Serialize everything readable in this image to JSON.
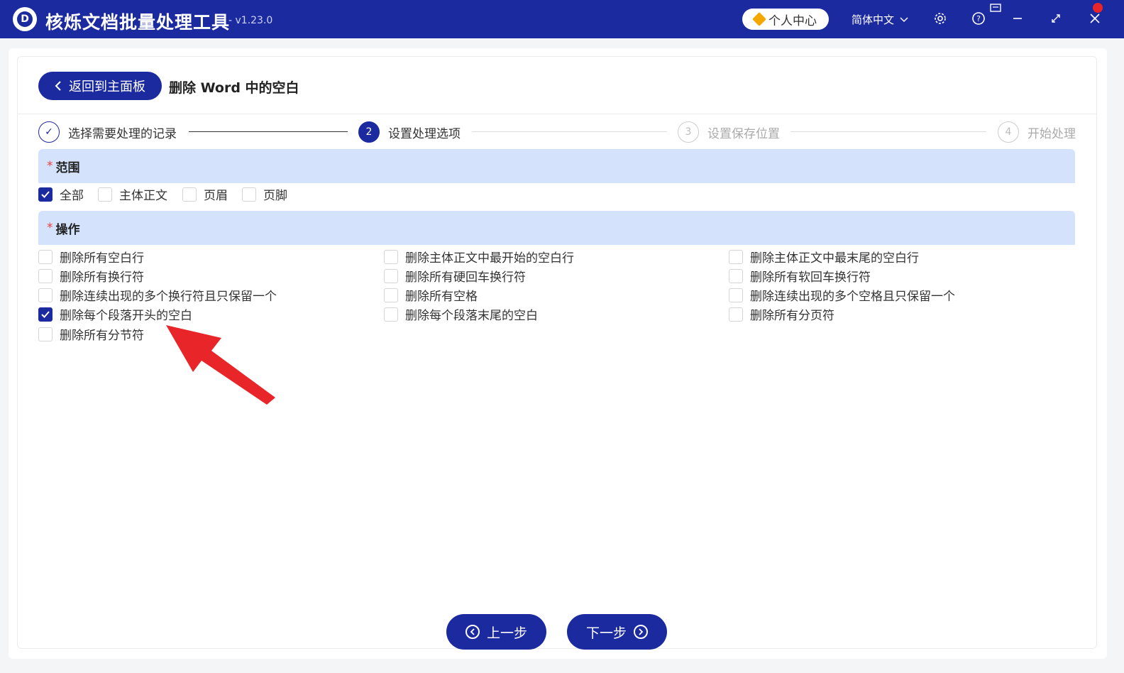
{
  "app": {
    "title": "核烁文档批量处理工具",
    "version": "- v1.23.0",
    "user_center": "个人中心",
    "language": "简体中文"
  },
  "header": {
    "back_label": "返回到主面板",
    "page_title": "删除 Word 中的空白"
  },
  "steps": [
    {
      "number": "✓",
      "label": "选择需要处理的记录",
      "state": "done"
    },
    {
      "number": "2",
      "label": "设置处理选项",
      "state": "active"
    },
    {
      "number": "3",
      "label": "设置保存位置",
      "state": "pending"
    },
    {
      "number": "4",
      "label": "开始处理",
      "state": "pending"
    }
  ],
  "scope": {
    "required_mark": "*",
    "title": "范围",
    "options": [
      {
        "label": "全部",
        "checked": true
      },
      {
        "label": "主体正文",
        "checked": false
      },
      {
        "label": "页眉",
        "checked": false
      },
      {
        "label": "页脚",
        "checked": false
      }
    ]
  },
  "operations": {
    "required_mark": "*",
    "title": "操作",
    "options": [
      {
        "label": "删除所有空白行",
        "checked": false
      },
      {
        "label": "删除主体正文中最开始的空白行",
        "checked": false
      },
      {
        "label": "删除主体正文中最末尾的空白行",
        "checked": false
      },
      {
        "label": "删除所有换行符",
        "checked": false
      },
      {
        "label": "删除所有硬回车换行符",
        "checked": false
      },
      {
        "label": "删除所有软回车换行符",
        "checked": false
      },
      {
        "label": "删除连续出现的多个换行符且只保留一个",
        "checked": false
      },
      {
        "label": "删除所有空格",
        "checked": false
      },
      {
        "label": "删除连续出现的多个空格且只保留一个",
        "checked": false
      },
      {
        "label": "删除每个段落开头的空白",
        "checked": true
      },
      {
        "label": "删除每个段落末尾的空白",
        "checked": false
      },
      {
        "label": "删除所有分页符",
        "checked": false
      },
      {
        "label": "删除所有分节符",
        "checked": false
      }
    ]
  },
  "footer": {
    "prev_label": "上一步",
    "next_label": "下一步"
  },
  "colors": {
    "primary": "#1c2aa0",
    "section_bg": "#d4e2fb",
    "required": "#e8413c",
    "annotation_arrow": "#e8262a"
  }
}
